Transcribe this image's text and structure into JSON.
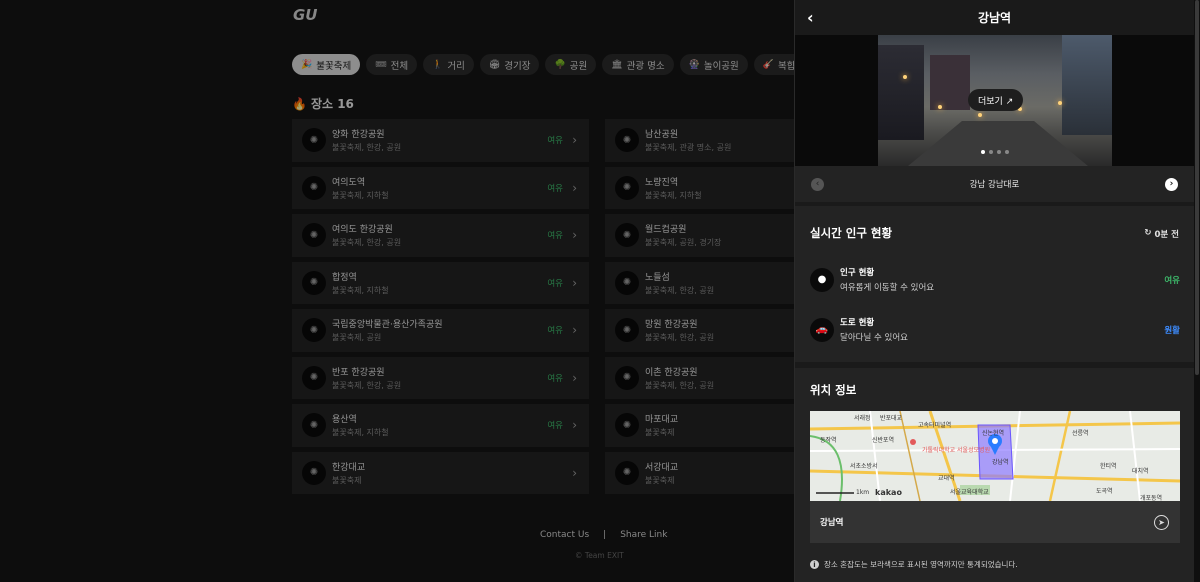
{
  "logo": "GU",
  "chips": [
    {
      "icon": "🎉",
      "label": "불꽃축제",
      "active": true
    },
    {
      "icon": "🎟",
      "label": "전체"
    },
    {
      "icon": "🚶",
      "label": "거리"
    },
    {
      "icon": "🏟",
      "label": "경기장"
    },
    {
      "icon": "🌳",
      "label": "공원"
    },
    {
      "icon": "🏛",
      "label": "관광 명소"
    },
    {
      "icon": "🎡",
      "label": "놀이공원"
    },
    {
      "icon": "🎸",
      "label": "복합문화공간"
    },
    {
      "icon": "🏬",
      "label": ""
    }
  ],
  "place_count": {
    "icon": "🔥",
    "label": "장소 16"
  },
  "places_left": [
    {
      "name": "양화 한강공원",
      "tags": "불꽃축제, 한강, 공원",
      "status": "여유"
    },
    {
      "name": "여의도역",
      "tags": "불꽃축제, 지하철",
      "status": "여유"
    },
    {
      "name": "여의도 한강공원",
      "tags": "불꽃축제, 한강, 공원",
      "status": "여유"
    },
    {
      "name": "합정역",
      "tags": "불꽃축제, 지하철",
      "status": "여유"
    },
    {
      "name": "국립중앙박물관·용산가족공원",
      "tags": "불꽃축제, 공원",
      "status": "여유"
    },
    {
      "name": "반포 한강공원",
      "tags": "불꽃축제, 한강, 공원",
      "status": "여유"
    },
    {
      "name": "용산역",
      "tags": "불꽃축제, 지하철",
      "status": "여유"
    },
    {
      "name": "한강대교",
      "tags": "불꽃축제",
      "status": ""
    }
  ],
  "places_right": [
    {
      "name": "남산공원",
      "tags": "불꽃축제, 관광 명소, 공원"
    },
    {
      "name": "노량진역",
      "tags": "불꽃축제, 지하철"
    },
    {
      "name": "월드컵공원",
      "tags": "불꽃축제, 공원, 경기장"
    },
    {
      "name": "노들섬",
      "tags": "불꽃축제, 한강, 공원"
    },
    {
      "name": "망원 한강공원",
      "tags": "불꽃축제, 한강, 공원"
    },
    {
      "name": "이촌 한강공원",
      "tags": "불꽃축제, 한강, 공원"
    },
    {
      "name": "마포대교",
      "tags": "불꽃축제"
    },
    {
      "name": "서강대교",
      "tags": "불꽃축제"
    }
  ],
  "footer": {
    "contact": "Contact Us",
    "sep": "|",
    "share": "Share Link",
    "copyright": "© Team EXIT"
  },
  "panel": {
    "title": "강남역",
    "more_button": "더보기 ↗",
    "camera_name": "강남 강남대로",
    "realtime_title": "실시간 인구 현황",
    "refresh_label": "0분 전",
    "people": {
      "label": "인구 현황",
      "desc": "여유롭게 이동할 수 있어요",
      "value": "여유",
      "color": "#3db86a"
    },
    "road": {
      "label": "도로 현황",
      "desc": "달아다닐 수 있어요",
      "value": "원활",
      "color": "#3d8cff"
    },
    "location_title": "위치 정보",
    "map_place": "강남역",
    "note": "장소 혼잡도는 보라색으로 표시된 영역까지만 통계되었습니다."
  },
  "map_labels": {
    "l1": "서래정",
    "l2": "반포대교",
    "l3": "고속터미널역",
    "l4": "신논현역",
    "l5": "선릉역",
    "l6": "동작역",
    "l7": "신반포역",
    "l8": "가톨릭대학교 서울성모병원",
    "l9": "서초소방서",
    "l10": "교대역",
    "l11": "강남역",
    "l12": "한티역",
    "l13": "대치역",
    "l14": "서울교육대학교",
    "l15": "도곡역",
    "l16": "개포동역",
    "scale": "1km",
    "brand": "kakao"
  }
}
